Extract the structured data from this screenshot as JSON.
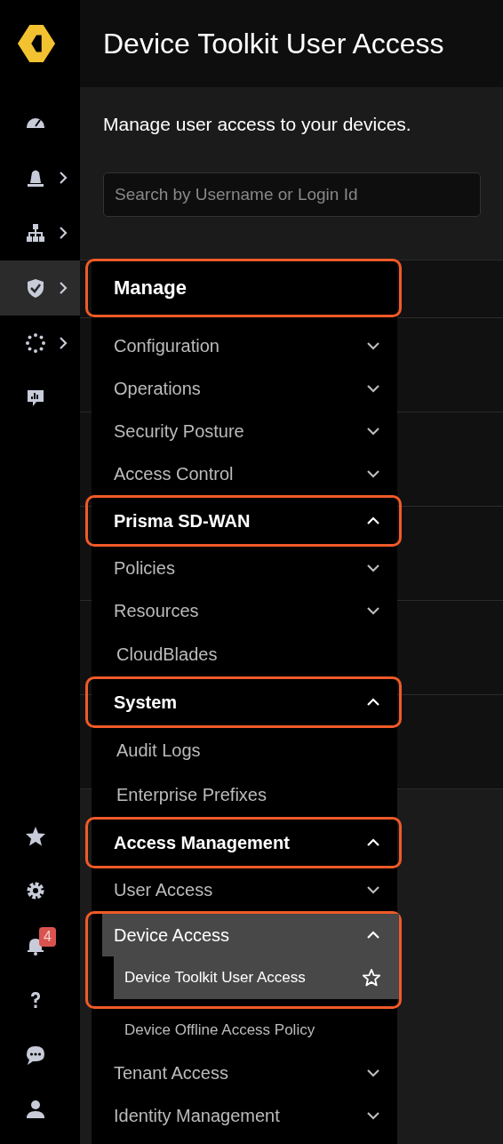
{
  "rail": {
    "top": [
      {
        "kind": "gauge",
        "has_submenu": false,
        "selected": false
      },
      {
        "kind": "alarm",
        "has_submenu": true,
        "selected": false
      },
      {
        "kind": "network",
        "has_submenu": true,
        "selected": false
      },
      {
        "kind": "shield",
        "has_submenu": true,
        "selected": true
      },
      {
        "kind": "dots",
        "has_submenu": true,
        "selected": false
      },
      {
        "kind": "chart",
        "has_submenu": false,
        "selected": false
      }
    ],
    "bottom": [
      {
        "kind": "star"
      },
      {
        "kind": "gear"
      },
      {
        "kind": "bell",
        "badge": "4"
      },
      {
        "kind": "help"
      },
      {
        "kind": "chat"
      },
      {
        "kind": "user"
      }
    ]
  },
  "page": {
    "title": "Device Toolkit User Access",
    "description": "Manage user access to your devices.",
    "search": {
      "placeholder": "Search by Username or Login Id"
    }
  },
  "menu": [
    {
      "kind": "heading",
      "label": "Manage",
      "highlighted": true
    },
    {
      "kind": "group",
      "label": "Configuration",
      "expanded": false
    },
    {
      "kind": "group",
      "label": "Operations",
      "expanded": false
    },
    {
      "kind": "group",
      "label": "Security Posture",
      "expanded": false
    },
    {
      "kind": "group",
      "label": "Access Control",
      "expanded": false
    },
    {
      "kind": "section",
      "label": "Prisma SD-WAN",
      "expanded": true,
      "highlighted": true
    },
    {
      "kind": "group",
      "label": "Policies",
      "expanded": false
    },
    {
      "kind": "group",
      "label": "Resources",
      "expanded": false
    },
    {
      "kind": "link",
      "label": "CloudBlades"
    },
    {
      "kind": "section",
      "label": "System",
      "expanded": true,
      "highlighted": true
    },
    {
      "kind": "link",
      "label": "Audit Logs"
    },
    {
      "kind": "link",
      "label": "Enterprise Prefixes"
    },
    {
      "kind": "section",
      "label": "Access Management",
      "expanded": true,
      "highlighted": true
    },
    {
      "kind": "group",
      "label": "User Access",
      "expanded": false
    },
    {
      "kind": "group",
      "label": "Device Access",
      "expanded": true,
      "selected": true,
      "highlighted": true,
      "children": [
        {
          "label": "Device Toolkit User Access",
          "selected": true
        },
        {
          "label": "Device Offline Access Policy",
          "selected": false
        }
      ]
    },
    {
      "kind": "group",
      "label": "Tenant Access",
      "expanded": false
    },
    {
      "kind": "group",
      "label": "Identity Management",
      "expanded": false
    }
  ]
}
